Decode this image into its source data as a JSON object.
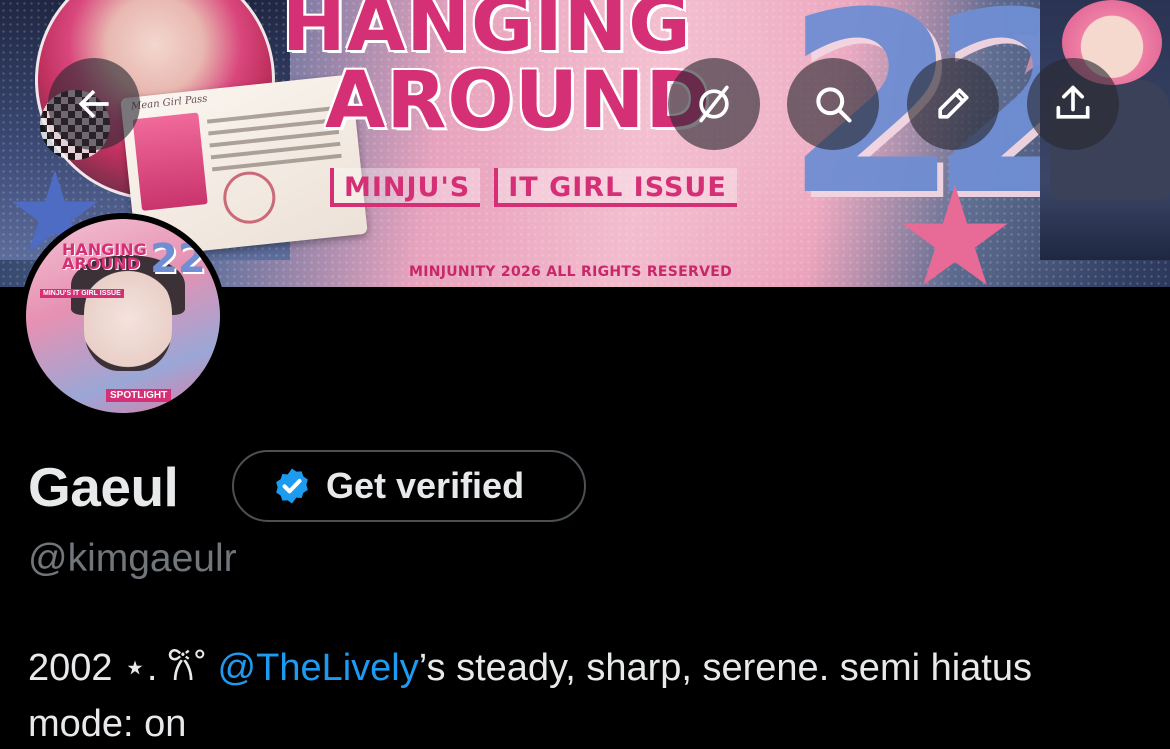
{
  "banner": {
    "title_line1": "HANGING",
    "title_line2": "AROUND",
    "number": "22",
    "issue_left": "MINJU'S",
    "issue_right": "IT GIRL ISSUE",
    "card_title": "Mean Girl Pass",
    "rights": "MINJUNITY 2026 ALL RIGHTS RESERVED"
  },
  "header": {
    "back_icon": "arrow-left-icon",
    "hide_icon": "eye-slash-icon",
    "search_icon": "search-icon",
    "edit_icon": "pencil-icon",
    "share_icon": "share-icon"
  },
  "avatar": {
    "title": "HANGING AROUND",
    "number": "22",
    "tag": "MINJU'S IT GIRL ISSUE",
    "spot": "SPOTLIGHT"
  },
  "profile": {
    "name": "Gaeul",
    "verify_label": "Get verified",
    "handle": "@kimgaeulr",
    "bio_prefix": "2002 ⋆. 𐙚˚ ",
    "bio_mention": "@TheLively",
    "bio_suffix": "’s steady, sharp, serene. semi hiatus mode: on"
  },
  "colors": {
    "background": "#000000",
    "text": "#e7e9ea",
    "muted": "#71767b",
    "link": "#1d9bf0",
    "verified_badge": "#1d9bf0",
    "banner_pink": "#d52f76",
    "banner_blue": "#6f8ed3"
  }
}
